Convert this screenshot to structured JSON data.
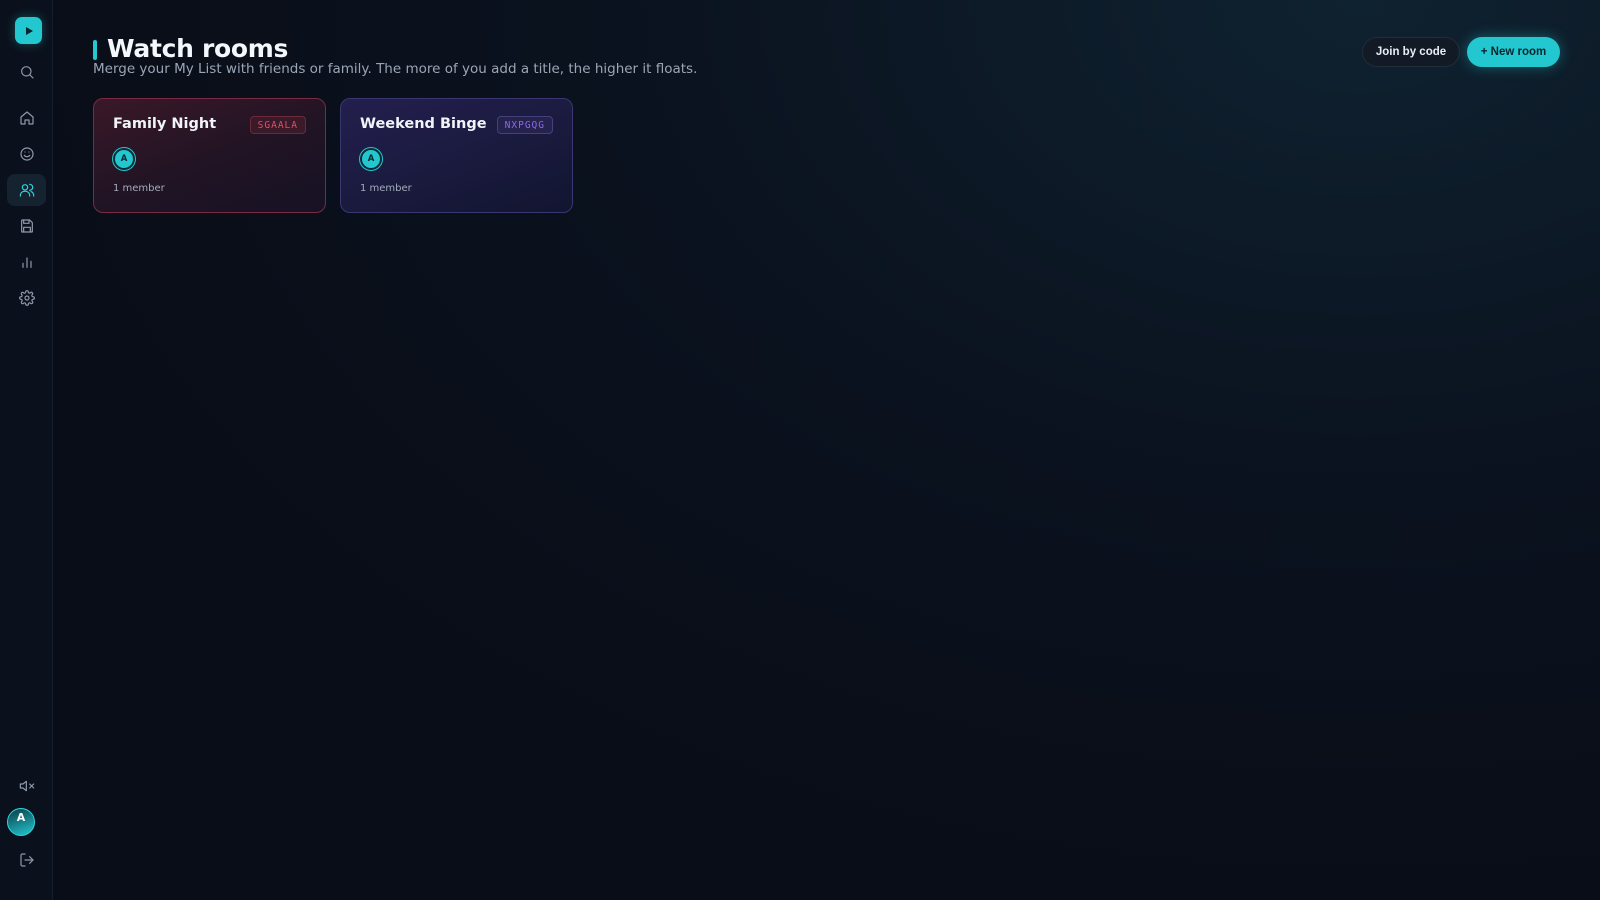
{
  "sidebar": {
    "logo_icon": "play-icon",
    "nav": [
      {
        "icon": "search-icon",
        "active": false
      },
      {
        "icon": "home-icon",
        "active": false
      },
      {
        "icon": "smile-icon",
        "active": false
      },
      {
        "icon": "users-icon",
        "active": true
      },
      {
        "icon": "save-icon",
        "active": false
      },
      {
        "icon": "bar-chart-icon",
        "active": false
      },
      {
        "icon": "gear-icon",
        "active": false
      }
    ],
    "bottom": [
      {
        "icon": "volume-mute-icon"
      },
      {
        "icon": "logout-icon"
      }
    ],
    "avatar_initial": "A"
  },
  "header": {
    "title": "Watch rooms",
    "subtitle": "Merge your My List with friends or family. The more of you add a title, the higher it floats.",
    "join_label": "Join by code",
    "new_label": "+ New room"
  },
  "rooms": [
    {
      "name": "Family Night",
      "code": "SGAALA",
      "member_initial": "A",
      "members": "1 member",
      "theme": "red"
    },
    {
      "name": "Weekend Binge",
      "code": "NXPGQG",
      "member_initial": "A",
      "members": "1 member",
      "theme": "purple"
    }
  ],
  "colors": {
    "accent": "#22c7d0",
    "background": "#0a0f1a",
    "red_badge": "#e0506a",
    "purple_badge": "#8a6ae8"
  }
}
